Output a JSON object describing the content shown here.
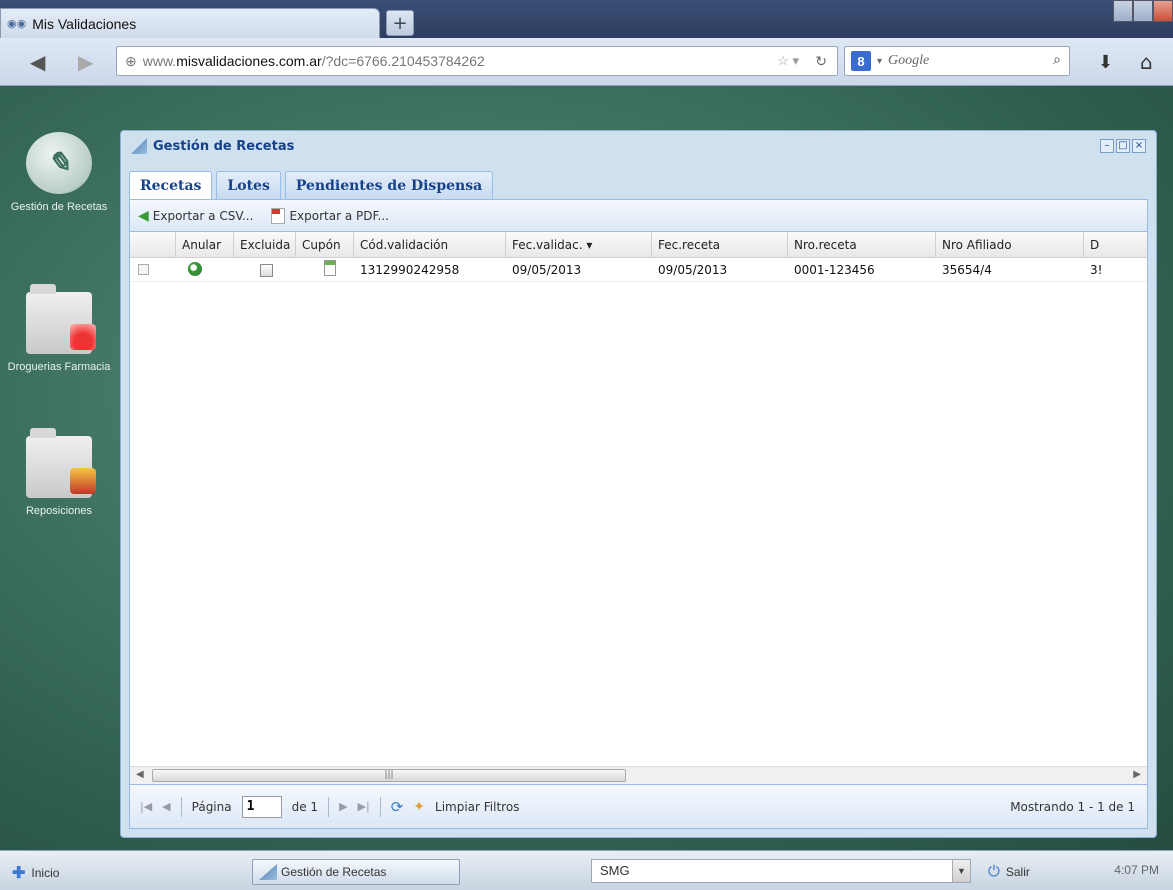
{
  "browser": {
    "tab_title": "Mis Validaciones",
    "new_tab_label": "+",
    "url_prefix": "www.",
    "url_domain": "misvalidaciones.com.ar",
    "url_rest": "/?dc=6766.210453784262",
    "search_placeholder": "Google"
  },
  "desktop": {
    "icons": [
      {
        "label": "Gestión de Recetas"
      },
      {
        "label": "Droguerias Farmacia"
      },
      {
        "label": "Reposiciones"
      }
    ]
  },
  "window": {
    "title": "Gestión de Recetas",
    "tabs": [
      {
        "label": "Recetas",
        "active": true
      },
      {
        "label": "Lotes",
        "active": false
      },
      {
        "label": "Pendientes de Dispensa",
        "active": false
      }
    ],
    "toolbar": {
      "export_csv": "Exportar a CSV...",
      "export_pdf": "Exportar a PDF..."
    },
    "grid": {
      "columns": [
        "Anular",
        "Excluida",
        "Cupón",
        "Cód.validación",
        "Fec.validac. ▾",
        "Fec.receta",
        "Nro.receta",
        "Nro Afiliado",
        "D"
      ],
      "rows": [
        {
          "cod_validacion": "1312990242958",
          "fec_validac": "09/05/2013",
          "fec_receta": "09/05/2013",
          "nro_receta": "0001-123456",
          "nro_afiliado": "35654/4",
          "d": "3!"
        }
      ]
    },
    "pager": {
      "page_label": "Página",
      "page_value": "1",
      "of_label": "de 1",
      "clear_filters": "Limpiar Filtros",
      "info": "Mostrando 1 - 1 de 1"
    }
  },
  "taskbar": {
    "start_label": "Inicio",
    "task_label": "Gestión de Recetas",
    "combo_value": "SMG",
    "salir_label": "Salir",
    "clock": "4:07 PM"
  },
  "colors": {
    "desktop_green": "#3f7566",
    "ext_blue": "#15428b",
    "border_blue": "#99bbe8"
  }
}
